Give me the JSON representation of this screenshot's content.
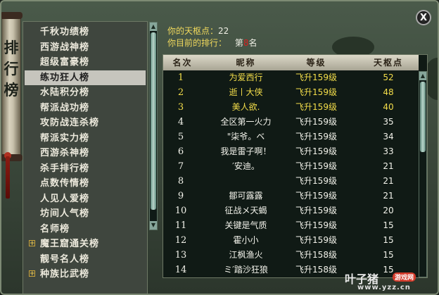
{
  "banner": {
    "text": "排行榜"
  },
  "menu": {
    "items": [
      {
        "label": "千秋功绩榜",
        "plus": false,
        "active": false
      },
      {
        "label": "西游战神榜",
        "plus": false,
        "active": false
      },
      {
        "label": "超级富豪榜",
        "plus": false,
        "active": false
      },
      {
        "label": "练功狂人榜",
        "plus": false,
        "active": true
      },
      {
        "label": "水陆积分榜",
        "plus": false,
        "active": false
      },
      {
        "label": "帮派战功榜",
        "plus": false,
        "active": false
      },
      {
        "label": "攻防战连杀榜",
        "plus": false,
        "active": false
      },
      {
        "label": "帮派实力榜",
        "plus": false,
        "active": false
      },
      {
        "label": "西游杀神榜",
        "plus": false,
        "active": false
      },
      {
        "label": "杀手排行榜",
        "plus": false,
        "active": false
      },
      {
        "label": "点数传情榜",
        "plus": false,
        "active": false
      },
      {
        "label": "人见人爱榜",
        "plus": false,
        "active": false
      },
      {
        "label": "坊间人气榜",
        "plus": false,
        "active": false
      },
      {
        "label": "名师榜",
        "plus": false,
        "active": false
      },
      {
        "label": "魔王窟通关榜",
        "plus": true,
        "active": false
      },
      {
        "label": "靓号名人榜",
        "plus": false,
        "active": false
      },
      {
        "label": "种族比武榜",
        "plus": true,
        "active": false
      }
    ]
  },
  "info": {
    "points_label": "你的天枢点：",
    "points_value": "22",
    "rank_label": "你目前的排行：",
    "rank_prefix": "第",
    "rank_value": "8",
    "rank_suffix": "名"
  },
  "table": {
    "headers": {
      "rank": "名次",
      "name": "昵称",
      "level": "等级",
      "points": "天枢点"
    },
    "rows": [
      {
        "rank": "1",
        "name": "为爱西行",
        "level": "飞升159级",
        "points": "52",
        "gold": true
      },
      {
        "rank": "2",
        "name": "逝丨大侠",
        "level": "飞升159级",
        "points": "48",
        "gold": true
      },
      {
        "rank": "3",
        "name": "美人欲.",
        "level": "飞升159级",
        "points": "40",
        "gold": true
      },
      {
        "rank": "4",
        "name": "全区第一火力",
        "level": "飞升159级",
        "points": "35",
        "gold": false
      },
      {
        "rank": "5",
        "name": "\"柒爷。ベ",
        "level": "飞升159级",
        "points": "34",
        "gold": false
      },
      {
        "rank": "6",
        "name": "我是雷子啊！",
        "level": "飞升159级",
        "points": "33",
        "gold": false
      },
      {
        "rank": "7",
        "name": "′安迪。",
        "level": "飞升159级",
        "points": "21",
        "gold": false
      },
      {
        "rank": "8",
        "name": "",
        "level": "飞升159级",
        "points": "21",
        "gold": false
      },
      {
        "rank": "9",
        "name": "鄒可露露",
        "level": "飞升159级",
        "points": "21",
        "gold": false
      },
      {
        "rank": "10",
        "name": "征战メ天蝎",
        "level": "飞升159级",
        "points": "20",
        "gold": false
      },
      {
        "rank": "11",
        "name": "关键是气质",
        "level": "飞升159级",
        "points": "15",
        "gold": false
      },
      {
        "rank": "12",
        "name": "霍小小",
        "level": "飞升159级",
        "points": "15",
        "gold": false
      },
      {
        "rank": "13",
        "name": "江枫渔火",
        "level": "飞升158级",
        "points": "15",
        "gold": false
      },
      {
        "rank": "14",
        "name": "ミ′踏沙狂狼",
        "level": "飞升158级",
        "points": "15",
        "gold": false
      }
    ]
  },
  "close": {
    "label": "X"
  },
  "watermark": {
    "brand": "叶子猪",
    "tag": "游戏网",
    "url": "www.yzz.cn"
  }
}
